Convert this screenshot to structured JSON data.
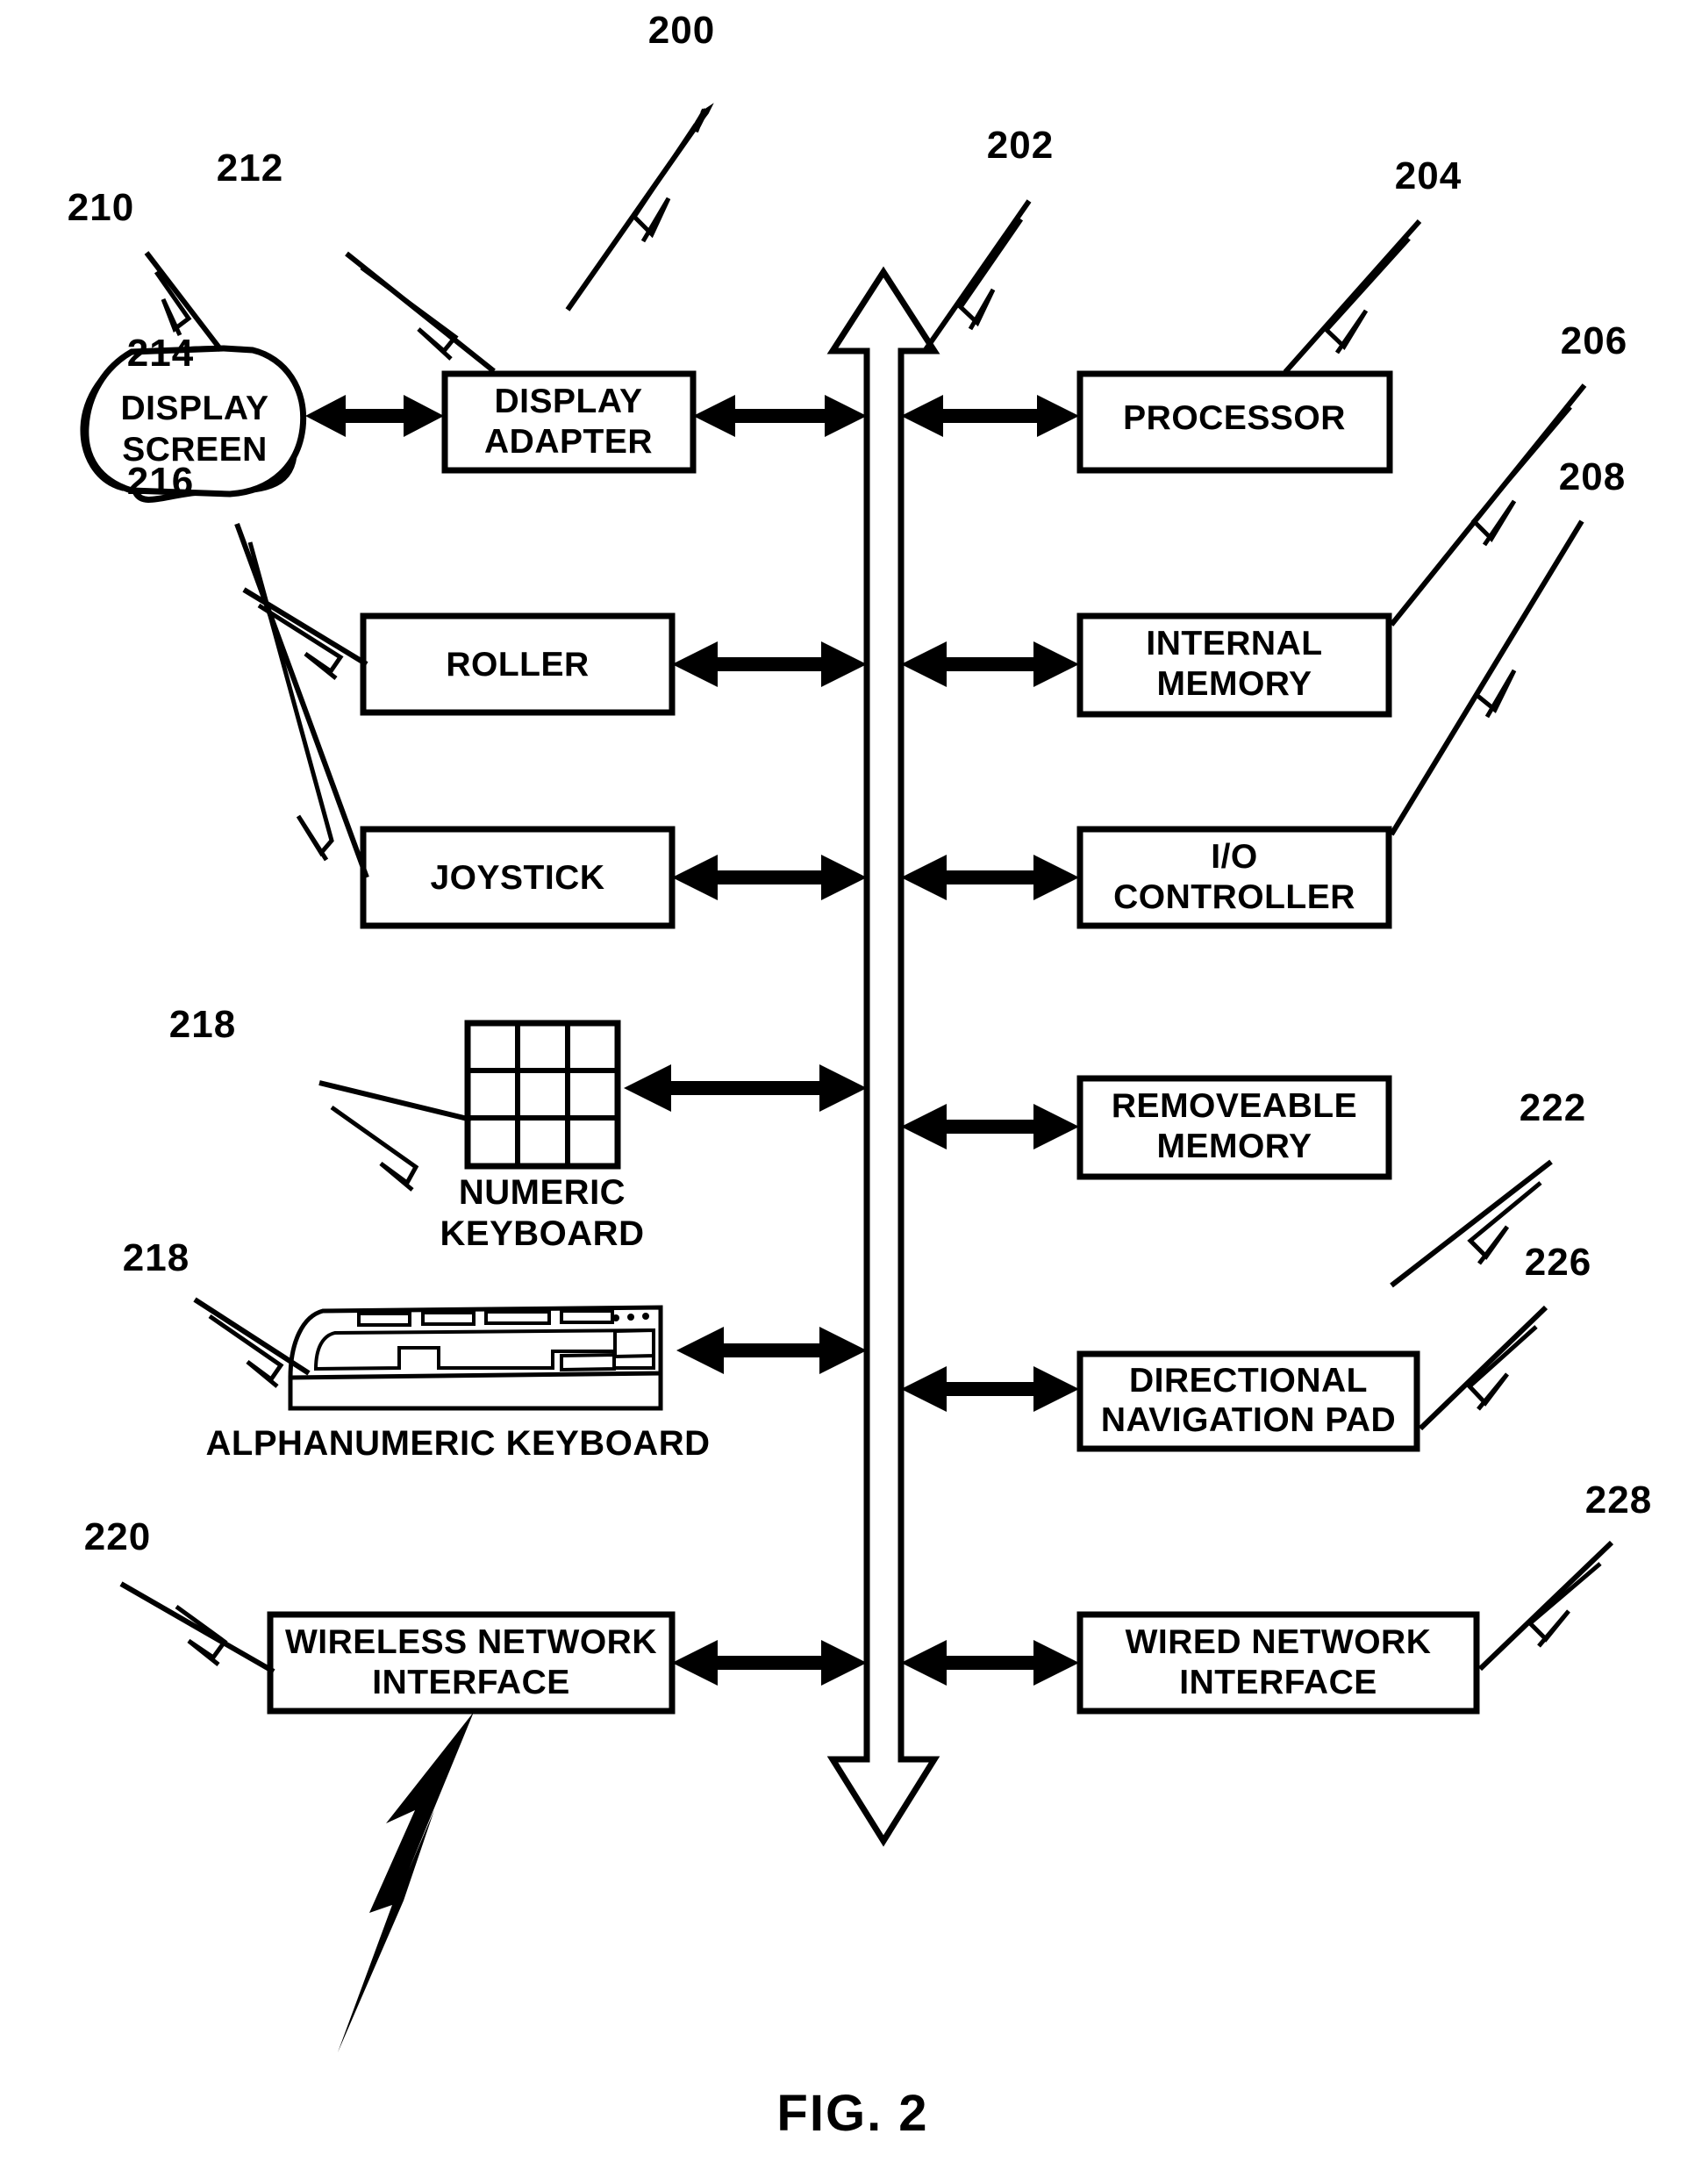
{
  "figure": {
    "caption": "FIG. 2",
    "system_ref": "200",
    "bus_ref": "202"
  },
  "reference_numerals": {
    "system": "200",
    "bus": "202",
    "processor": "204",
    "internal_memory": "206",
    "io_controller": "208",
    "display_screen": "210",
    "display_adapter": "212",
    "roller": "214",
    "joystick": "216",
    "numeric_keyboard": "218",
    "alphanumeric_keyboard": "218",
    "wireless_network_interface": "220",
    "removeable_memory": "222",
    "directional_navigation_pad": "226",
    "wired_network_interface": "228"
  },
  "blocks": {
    "display_screen": {
      "label_line1": "DISPLAY",
      "label_line2": "SCREEN",
      "ref": "210"
    },
    "display_adapter": {
      "label_line1": "DISPLAY",
      "label_line2": "ADAPTER",
      "ref": "212"
    },
    "processor": {
      "label_line1": "PROCESSOR",
      "label_line2": "",
      "ref": "204"
    },
    "roller": {
      "label_line1": "ROLLER",
      "label_line2": "",
      "ref": "214"
    },
    "internal_memory": {
      "label_line1": "INTERNAL",
      "label_line2": "MEMORY",
      "ref": "206"
    },
    "joystick": {
      "label_line1": "JOYSTICK",
      "label_line2": "",
      "ref": "216"
    },
    "io_controller": {
      "label_line1": "I/O",
      "label_line2": "CONTROLLER",
      "ref": "208"
    },
    "numeric_keyboard": {
      "label_line1": "NUMERIC",
      "label_line2": "KEYBOARD",
      "ref": "218"
    },
    "removeable_memory": {
      "label_line1": "REMOVEABLE",
      "label_line2": "MEMORY",
      "ref": "222"
    },
    "alphanumeric_keyboard": {
      "label_line1": "ALPHANUMERIC KEYBOARD",
      "label_line2": "",
      "ref": "218"
    },
    "directional_navigation_pad": {
      "label_line1": "DIRECTIONAL",
      "label_line2": "NAVIGATION PAD",
      "ref": "226"
    },
    "wireless_network_interface": {
      "label_line1": "WIRELESS NETWORK",
      "label_line2": "INTERFACE",
      "ref": "220"
    },
    "wired_network_interface": {
      "label_line1": "WIRED NETWORK",
      "label_line2": "INTERFACE",
      "ref": "228"
    }
  },
  "colors": {
    "ink": "#000000",
    "paper": "#ffffff"
  }
}
